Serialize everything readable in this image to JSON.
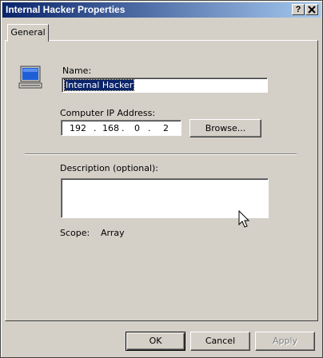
{
  "window": {
    "title": "Internal Hacker Properties",
    "help_button": "?",
    "close_button": "✕"
  },
  "tabs": [
    {
      "label": "General"
    }
  ],
  "general": {
    "name_label": "Name:",
    "name_value": "Internal Hacker",
    "ip_label": "Computer IP Address:",
    "ip_octets": [
      "192",
      "168",
      "0",
      "2"
    ],
    "ip_separator": ".",
    "browse_label": "Browse...",
    "description_label": "Description (optional):",
    "description_value": "",
    "scope_label": "Scope:",
    "scope_value": "Array"
  },
  "buttons": {
    "ok": "OK",
    "cancel": "Cancel",
    "apply": "Apply"
  },
  "icons": {
    "entity": "computer-icon",
    "pointer": "mouse-pointer-icon"
  }
}
